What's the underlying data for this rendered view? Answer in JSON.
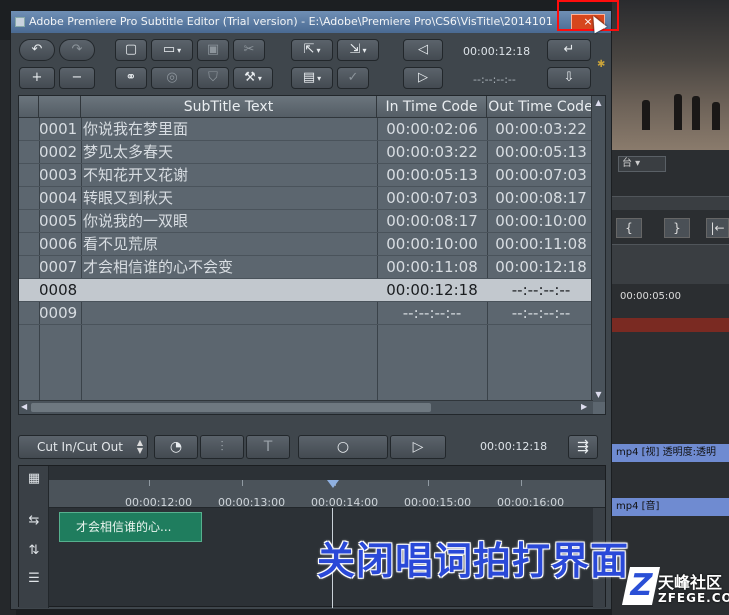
{
  "window": {
    "title": "Adobe Premiere Pro Subtitle Editor (Trial version) - E:\\Adobe\\Premiere Pro\\CS6\\VisTitle\\2014101",
    "close_label": "×"
  },
  "toolbar": {
    "timecode": "00:00:12:18",
    "timecode_empty": "--:--:--:--"
  },
  "table": {
    "headers": [
      "SubTitle Text",
      "In Time Code",
      "Out Time Code"
    ],
    "rows": [
      {
        "id": "0001",
        "text": "你说我在梦里面",
        "in": "00:00:02:06",
        "out": "00:00:03:22"
      },
      {
        "id": "0002",
        "text": "梦见太多春天",
        "in": "00:00:03:22",
        "out": "00:00:05:13"
      },
      {
        "id": "0003",
        "text": "不知花开又花谢",
        "in": "00:00:05:13",
        "out": "00:00:07:03"
      },
      {
        "id": "0004",
        "text": "转眼又到秋天",
        "in": "00:00:07:03",
        "out": "00:00:08:17"
      },
      {
        "id": "0005",
        "text": "你说我的一双眼",
        "in": "00:00:08:17",
        "out": "00:00:10:00"
      },
      {
        "id": "0006",
        "text": "看不见荒原",
        "in": "00:00:10:00",
        "out": "00:00:11:08"
      },
      {
        "id": "0007",
        "text": "才会相信谁的心不会变",
        "in": "00:00:11:08",
        "out": "00:00:12:18"
      },
      {
        "id": "0008",
        "text": "",
        "in": "00:00:12:18",
        "out": "--:--:--:--"
      },
      {
        "id": "0009",
        "text": "",
        "in": "--:--:--:--",
        "out": "--:--:--:--"
      }
    ],
    "selected_index": 7
  },
  "playback": {
    "mode": "Cut In/Cut Out",
    "timecode": "00:00:12:18"
  },
  "timeline": {
    "ruler_labels": [
      "00:00:12:00",
      "00:00:13:00",
      "00:00:14:00",
      "00:00:15:00",
      "00:00:16:00"
    ],
    "clip_text": "才会相信谁的心..."
  },
  "background": {
    "dropdown": "台",
    "time": "00:00:05:00",
    "clip_video": "mp4 [视] 透明度:透明",
    "clip_audio": "mp4 [音]"
  },
  "overlay": {
    "caption": "关闭唱词拍打界面",
    "watermark_text": "天峰社区",
    "watermark_site": "ZFEGE.COM"
  },
  "colors": {
    "titlebar": "#5b7ba3",
    "close": "#d6461d",
    "highlight_box": "#ff0d0d",
    "clip": "#1f7d5e",
    "caption": "#2a49d8"
  }
}
